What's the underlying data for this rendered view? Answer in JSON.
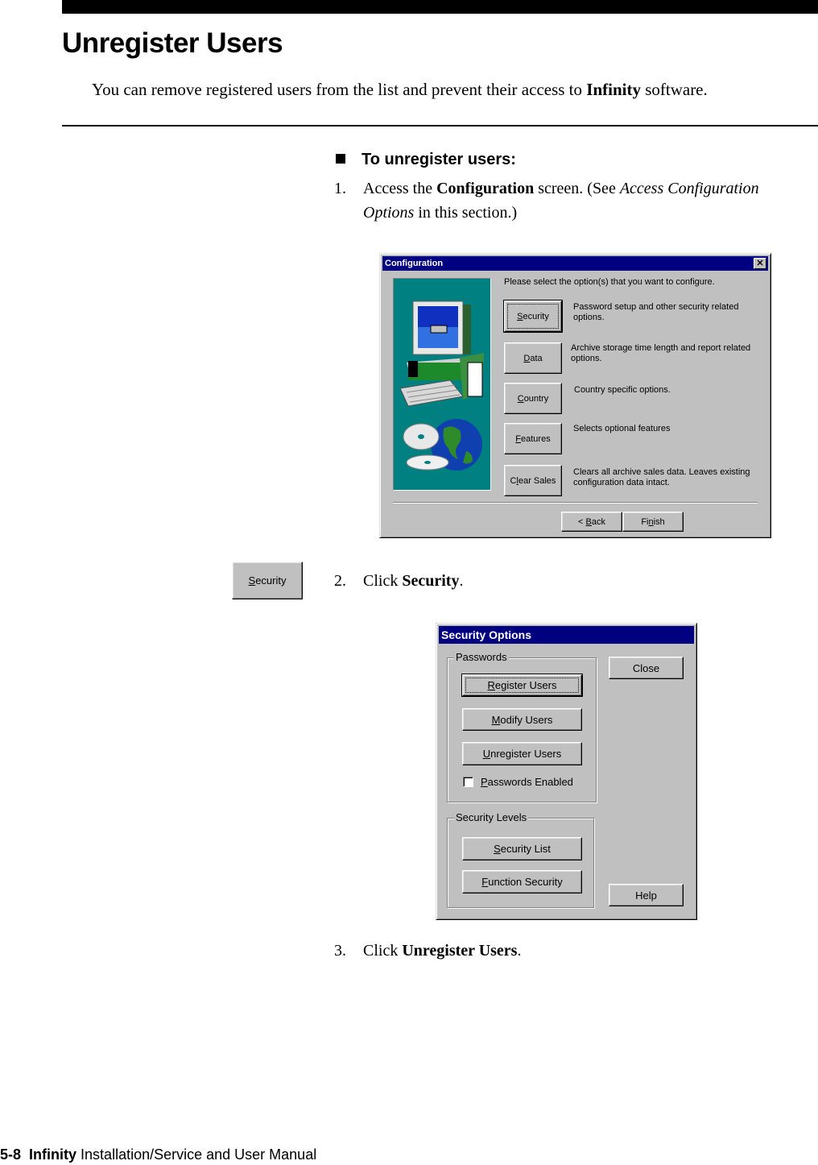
{
  "page": {
    "title": "Unregister Users",
    "intro": {
      "before": "You can remove registered users from the list and prevent their access to ",
      "product": "Infinity",
      "after": " software."
    },
    "procedure_heading": "To unregister users:",
    "steps": [
      {
        "num": "1.",
        "parts": [
          "Access the ",
          "Configuration",
          " screen. (See ",
          "Access Configuration",
          "Options",
          " in this section.)"
        ]
      },
      {
        "num": "2.",
        "parts": [
          "Click ",
          "Security",
          "."
        ]
      },
      {
        "num": "3.",
        "parts": [
          "Click ",
          "Unregister Users",
          "."
        ]
      }
    ],
    "footer": {
      "page_number": "5-8",
      "product": "Infinity",
      "manual": "Installation/Service and User Manual"
    }
  },
  "configuration_dialog": {
    "title": "Configuration",
    "close_glyph": "✕",
    "prompt": "Please select the option(s) that you want to configure.",
    "options": [
      {
        "mnemonic": "S",
        "rest": "ecurity",
        "desc1": "Password setup and other security related",
        "desc2": "options."
      },
      {
        "mnemonic": "D",
        "rest": "ata",
        "desc1": "Archive storage time length and report related",
        "desc2": "options."
      },
      {
        "mnemonic": "C",
        "rest": "ountry",
        "desc1": "Country specific options.",
        "desc2": ""
      },
      {
        "mnemonic": "F",
        "rest": "eatures",
        "desc1": "Selects optional features",
        "desc2": ""
      },
      {
        "pre": "C",
        "mnemonic": "l",
        "rest": "ear Sales",
        "desc1": "Clears all archive sales data.  Leaves existing",
        "desc2": "configuration data intact."
      }
    ],
    "back": {
      "pre": "< ",
      "mnemonic": "B",
      "rest": "ack"
    },
    "finish": {
      "pre": "Fi",
      "mnemonic": "n",
      "rest": "ish"
    }
  },
  "security_button_icon": {
    "mnemonic": "S",
    "rest": "ecurity"
  },
  "security_options_dialog": {
    "title": "Security Options",
    "passwords_group": "Passwords",
    "register": {
      "mnemonic": "R",
      "rest": "egister Users"
    },
    "modify": {
      "mnemonic": "M",
      "rest": "odify Users"
    },
    "unregister": {
      "mnemonic": "U",
      "rest": "nregister Users"
    },
    "passwords_enabled": {
      "mnemonic": "P",
      "rest": "asswords Enabled",
      "checked": false
    },
    "levels_group": "Security Levels",
    "security_list": {
      "mnemonic": "S",
      "rest": "ecurity List"
    },
    "function_security": {
      "mnemonic": "F",
      "rest": "unction Security"
    },
    "close": "Close",
    "help": "Help"
  },
  "colors": {
    "titlebar": "#000080",
    "dialog_face": "#c0c0c0",
    "art_background": "#008080"
  }
}
